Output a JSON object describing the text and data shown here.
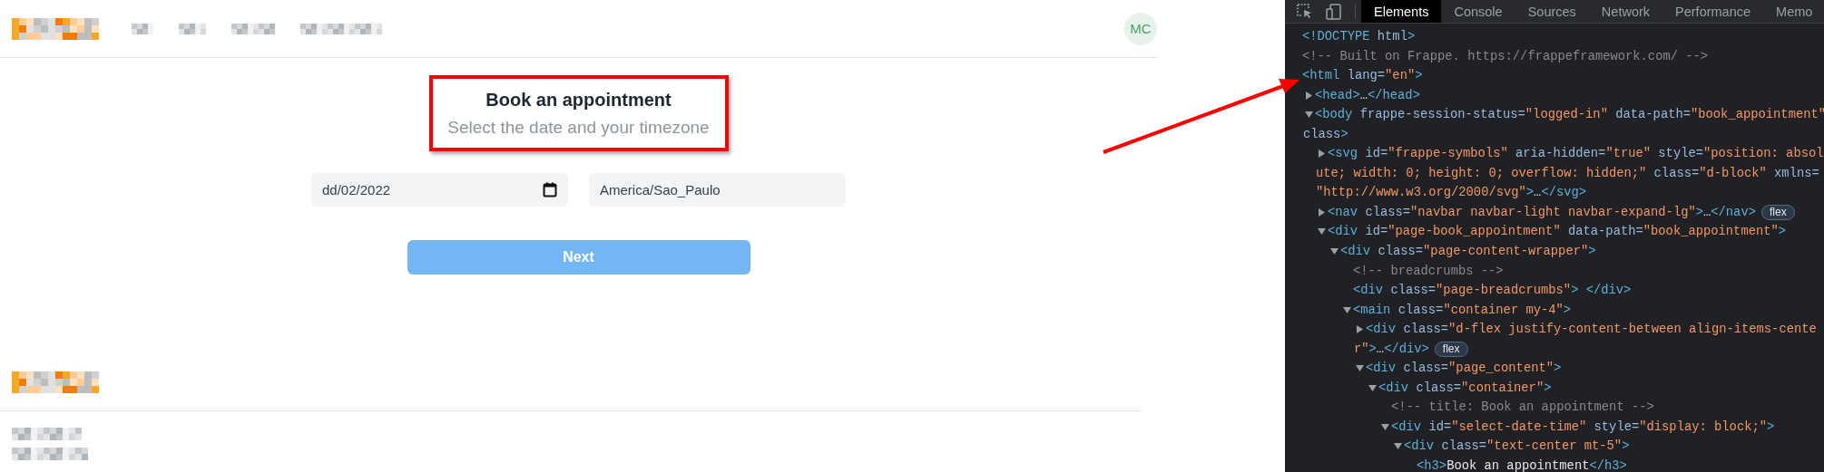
{
  "header": {
    "avatar": "MC"
  },
  "booking": {
    "title": "Book an appointment",
    "subtitle": "Select the date and your timezone",
    "date_field": {
      "value": "dd/02/2022"
    },
    "timezone_field": {
      "value": "America/Sao_Paulo"
    },
    "next_button": {
      "label": "Next",
      "disabled": true
    }
  },
  "devtools": {
    "tabs": [
      {
        "label": "Elements",
        "selected": true
      },
      {
        "label": "Console",
        "selected": false
      },
      {
        "label": "Sources",
        "selected": false
      },
      {
        "label": "Network",
        "selected": false
      },
      {
        "label": "Performance",
        "selected": false
      },
      {
        "label": "Memo",
        "selected": false
      }
    ],
    "tree": [
      {
        "kind": "tag",
        "lines": [
          "<!DOCTYPE html>"
        ]
      },
      {
        "kind": "comment",
        "lines": [
          "<!-- Built on Frappe. https://frappeframework.com/ -->"
        ]
      },
      {
        "kind": "tag",
        "lines": [
          "<html lang=\"en\">"
        ],
        "children": [
          {
            "kind": "tag",
            "expanded": false,
            "lines": [
              "<head>…</head>"
            ]
          },
          {
            "kind": "tag",
            "expanded": true,
            "lines": [
              "<body frappe-session-status=\"logged-in\" data-path=\"book_appointment\"",
              "class>"
            ],
            "children": [
              {
                "kind": "tag",
                "expanded": false,
                "lines": [
                  "<svg id=\"frappe-symbols\" aria-hidden=\"true\" style=\"position: absol",
                  "ute; width: 0; height: 0; overflow: hidden;\" class=\"d-block\" xmlns=",
                  "\"http://www.w3.org/2000/svg\">…</svg>"
                ]
              },
              {
                "kind": "tag",
                "expanded": false,
                "lines": [
                  "<nav class=\"navbar navbar-light navbar-expand-lg\">…</nav>"
                ],
                "badge": "flex"
              },
              {
                "kind": "tag",
                "expanded": true,
                "lines": [
                  "<div id=\"page-book_appointment\" data-path=\"book_appointment\">"
                ],
                "children": [
                  {
                    "kind": "tag",
                    "expanded": true,
                    "lines": [
                      "<div class=\"page-content-wrapper\">"
                    ],
                    "children": [
                      {
                        "kind": "comment",
                        "lines": [
                          "<!-- breadcrumbs -->"
                        ]
                      },
                      {
                        "kind": "tag",
                        "lines": [
                          "<div class=\"page-breadcrumbs\"> </div>"
                        ]
                      },
                      {
                        "kind": "tag",
                        "expanded": true,
                        "lines": [
                          "<main class=\"container my-4\">"
                        ],
                        "children": [
                          {
                            "kind": "tag",
                            "expanded": false,
                            "lines": [
                              "<div class=\"d-flex justify-content-between align-items-cente",
                              "r\">…</div>"
                            ],
                            "badge": "flex"
                          },
                          {
                            "kind": "tag",
                            "expanded": true,
                            "lines": [
                              "<div class=\"page_content\">"
                            ],
                            "children": [
                              {
                                "kind": "tag",
                                "expanded": true,
                                "lines": [
                                  "<div class=\"container\">"
                                ],
                                "children": [
                                  {
                                    "kind": "comment",
                                    "lines": [
                                      "<!-- title: Book an appointment -->"
                                    ]
                                  },
                                  {
                                    "kind": "tag",
                                    "expanded": true,
                                    "lines": [
                                      "<div id=\"select-date-time\" style=\"display: block;\">"
                                    ],
                                    "children": [
                                      {
                                        "kind": "tag",
                                        "expanded": true,
                                        "lines": [
                                          "<div class=\"text-center mt-5\">"
                                        ],
                                        "children": [
                                          {
                                            "kind": "tag",
                                            "lines": [
                                              "<h3>Book an appointment</h3>"
                                            ]
                                          }
                                        ]
                                      }
                                    ]
                                  }
                                ]
                              }
                            ]
                          }
                        ]
                      }
                    ]
                  }
                ]
              }
            ]
          }
        ]
      }
    ]
  }
}
